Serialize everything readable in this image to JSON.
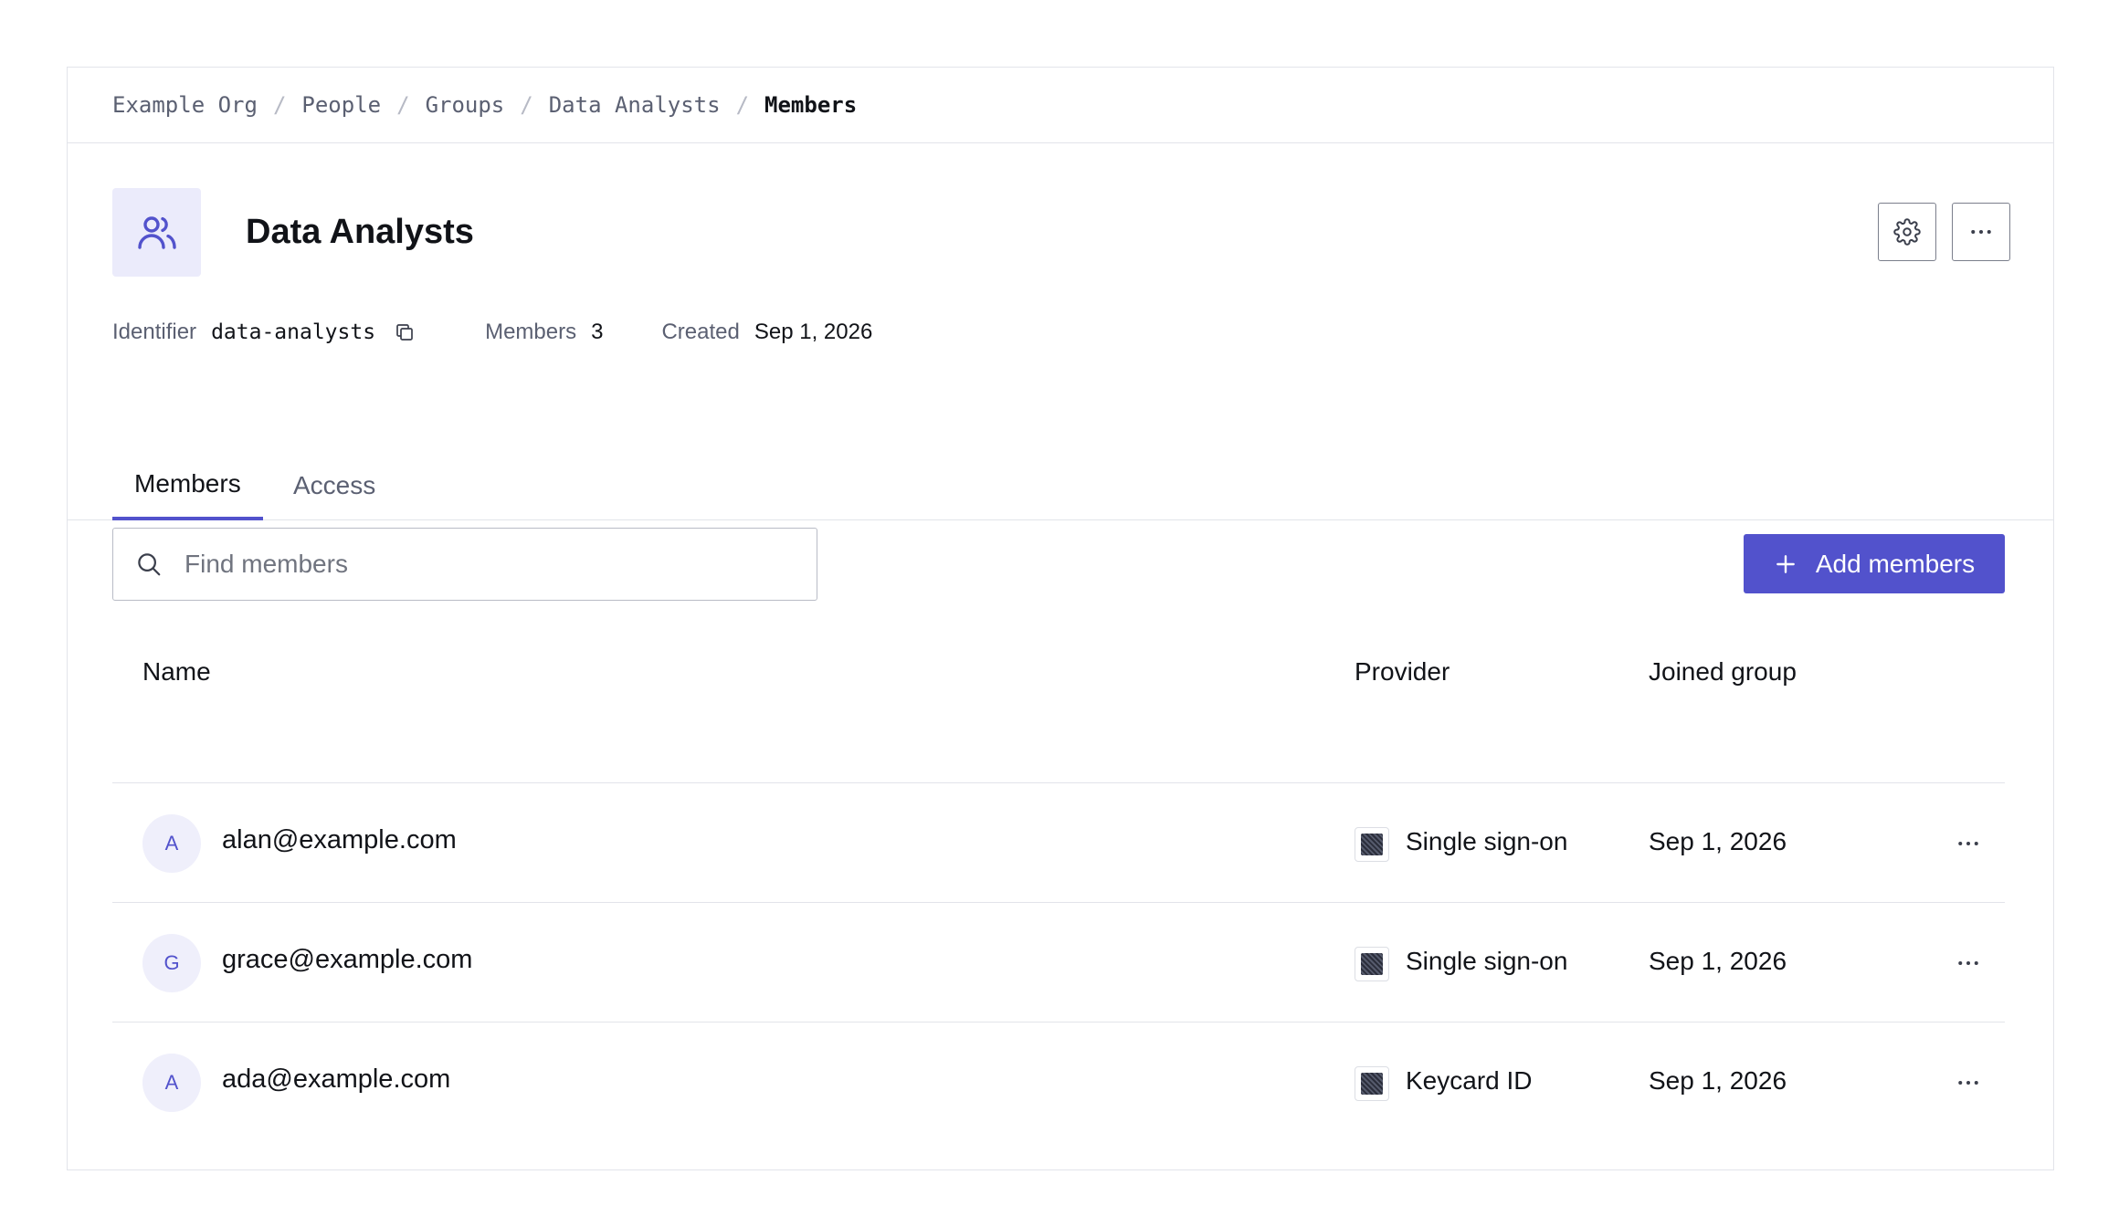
{
  "breadcrumb": {
    "items": [
      "Example Org",
      "People",
      "Groups",
      "Data Analysts"
    ],
    "current": "Members",
    "separator": "/"
  },
  "group": {
    "title": "Data Analysts",
    "icon": "users-icon"
  },
  "meta": {
    "identifier_label": "Identifier",
    "identifier_value": "data-analysts",
    "members_label": "Members",
    "members_value": "3",
    "created_label": "Created",
    "created_value": "Sep 1, 2026"
  },
  "tabs": [
    {
      "label": "Members",
      "active": true
    },
    {
      "label": "Access",
      "active": false
    }
  ],
  "search": {
    "placeholder": "Find members",
    "value": ""
  },
  "add_button": {
    "label": "Add members"
  },
  "table": {
    "headers": {
      "name": "Name",
      "provider": "Provider",
      "joined": "Joined group"
    },
    "rows": [
      {
        "initial": "A",
        "email": "alan@example.com",
        "provider": "Single sign-on",
        "joined": "Sep 1, 2026"
      },
      {
        "initial": "G",
        "email": "grace@example.com",
        "provider": "Single sign-on",
        "joined": "Sep 1, 2026"
      },
      {
        "initial": "A",
        "email": "ada@example.com",
        "provider": "Keycard ID",
        "joined": "Sep 1, 2026"
      }
    ]
  },
  "colors": {
    "accent": "#5252cc",
    "accent_bg": "#ebebfb",
    "border": "#e2e4ea",
    "muted_text": "#5b6072"
  }
}
